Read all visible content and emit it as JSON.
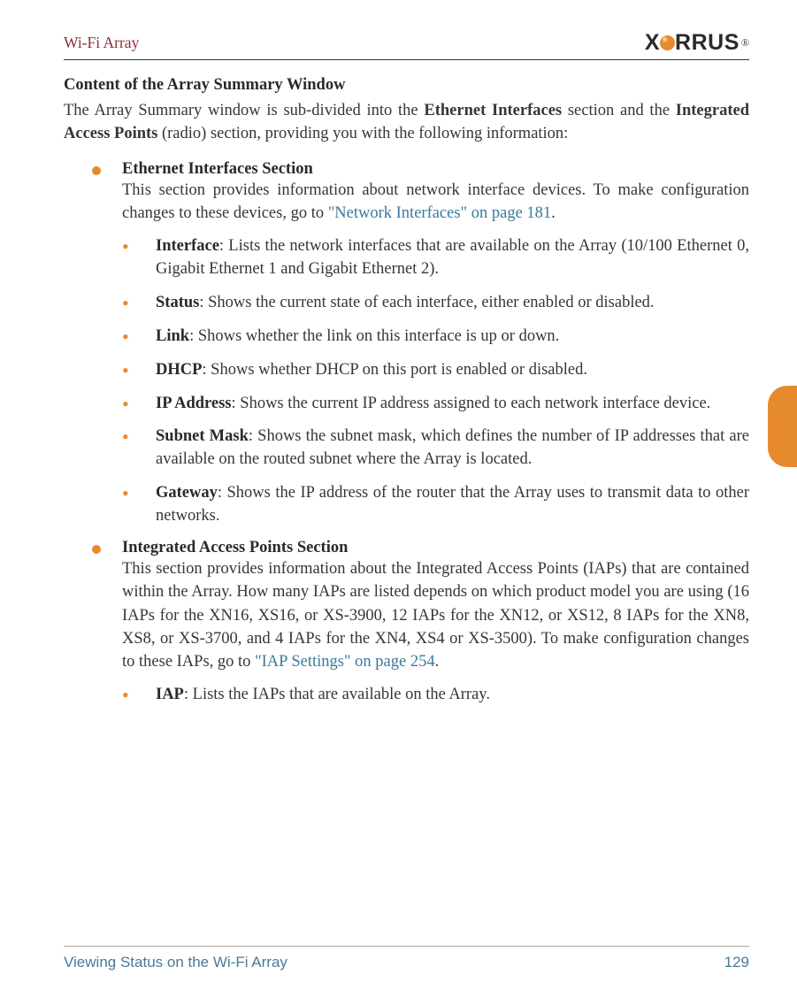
{
  "header": {
    "doc_title": "Wi-Fi Array",
    "logo_text_1": "X",
    "logo_text_2": "RRUS"
  },
  "heading": "Content of the Array Summary Window",
  "intro": {
    "pre": "The Array Summary window is sub-divided into the ",
    "bold1": "Ethernet Interfaces",
    "mid": " section and the ",
    "bold2": "Integrated Access Points",
    "post": " (radio) section, providing you with the following information:"
  },
  "eth": {
    "title": "Ethernet Interfaces Section",
    "body_pre": "This section provides information about network interface devices. To make configuration changes to these devices, go to ",
    "body_link": "\"Network Interfaces\" on page 181",
    "body_post": ".",
    "items": [
      {
        "label": "Interface",
        "text": ": Lists the network interfaces that are available on the Array (10/100 Ethernet 0, Gigabit Ethernet 1 and Gigabit Ethernet 2)."
      },
      {
        "label": "Status",
        "text": ": Shows the current state of each interface, either enabled or disabled."
      },
      {
        "label": "Link",
        "text": ": Shows whether the link on this interface is up or down."
      },
      {
        "label": "DHCP",
        "text": ": Shows whether DHCP on this port is enabled or disabled."
      },
      {
        "label": "IP Address",
        "text": ": Shows the current IP address assigned to each network interface device."
      },
      {
        "label": "Subnet Mask",
        "text": ": Shows the subnet mask, which defines the number of IP addresses that are available on the routed subnet where the Array is located."
      },
      {
        "label": "Gateway",
        "text": ": Shows the IP address of the router that the Array uses to transmit data to other networks."
      }
    ]
  },
  "iap": {
    "title": "Integrated Access Points Section",
    "body_pre": "This section provides information about the Integrated Access Points (IAPs) that are contained within the Array. How many IAPs are listed depends on which product model you are using (16 IAPs for the XN16, XS16, or XS-3900, 12 IAPs for the XN12, or XS12, 8 IAPs for the XN8, XS8, or XS-3700, and 4 IAPs for the XN4, XS4 or XS-3500). To make configuration changes to these IAPs, go to ",
    "body_link": "\"IAP Settings\" on page 254",
    "body_post": ".",
    "items": [
      {
        "label": "IAP",
        "text": ": Lists the IAPs that are available on the Array."
      }
    ]
  },
  "footer": {
    "left": "Viewing Status on the Wi-Fi Array",
    "page": "129"
  }
}
